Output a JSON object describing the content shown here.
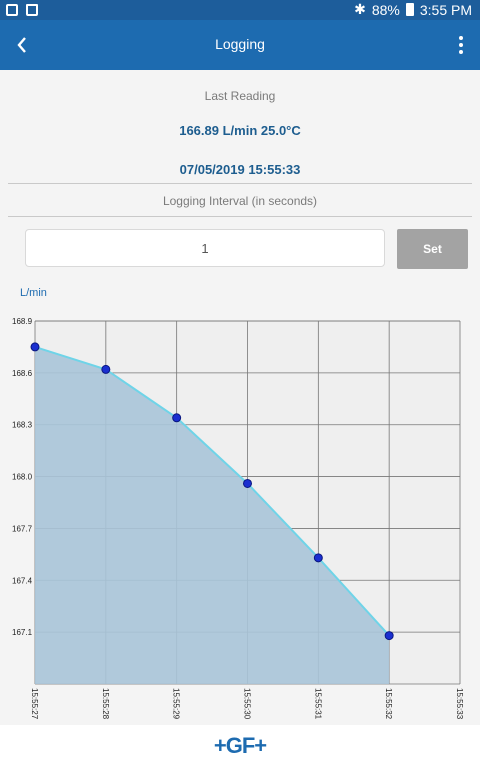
{
  "status_bar": {
    "battery": "88%",
    "time": "3:55 PM"
  },
  "app_bar": {
    "title": "Logging"
  },
  "last_reading": {
    "label": "Last Reading",
    "value": "166.89 L/min 25.0°C",
    "timestamp": "07/05/2019 15:55:33"
  },
  "logging_interval": {
    "label": "Logging Interval (in seconds)",
    "value": "1",
    "set_label": "Set"
  },
  "chart": {
    "unit_label": "L/min"
  },
  "chart_data": {
    "type": "area",
    "x": [
      "15:55:27",
      "15:55:28",
      "15:55:29",
      "15:55:30",
      "15:55:31",
      "15:55:32",
      "15:55:33"
    ],
    "values": [
      168.75,
      168.62,
      168.34,
      167.96,
      167.53,
      167.08
    ],
    "yticks": [
      "168.9",
      "168.6",
      "168.3",
      "168.0",
      "167.7",
      "167.4",
      "167.1"
    ],
    "ylabel": "L/min",
    "ylim": [
      166.8,
      168.9
    ],
    "grid": true,
    "colors": {
      "fill": "#a8c4d8",
      "line": "#6fd4e8",
      "point": "#1a2fd0"
    }
  },
  "footer": {
    "logo": "+GF+"
  }
}
